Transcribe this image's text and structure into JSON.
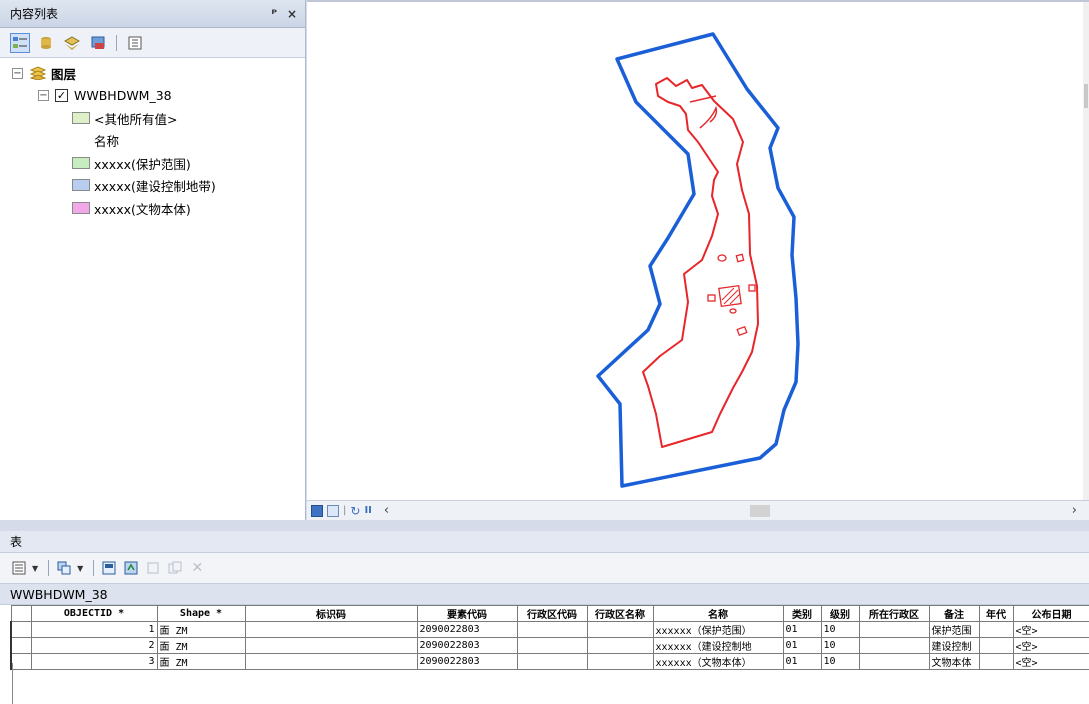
{
  "toc": {
    "title": "内容列表",
    "pin_glyph": "ᴾ",
    "close_glyph": "×",
    "tree": {
      "root_label": "图层",
      "layer_label": "WWBHDWM_38",
      "legend": [
        {
          "label": "<其他所有值>",
          "color": "#dff0c8"
        },
        {
          "label": "名称",
          "color": null
        },
        {
          "label": "xxxxx(保护范围)",
          "color": "#c6ecc0"
        },
        {
          "label": "xxxxx(建设控制地带)",
          "color": "#b8cdf0"
        },
        {
          "label": "xxxxx(文物本体)",
          "color": "#f0a8e8"
        }
      ]
    }
  },
  "table_panel": {
    "title": "表",
    "tab_label": "WWBHDWM_38",
    "columns": [
      "OBJECTID *",
      "Shape *",
      "标识码",
      "要素代码",
      "行政区代码",
      "行政区名称",
      "名称",
      "类别",
      "级别",
      "所在行政区",
      "备注",
      "年代",
      "公布日期"
    ],
    "rows": [
      [
        "1",
        "面 ZM",
        "",
        "2090022803",
        "",
        "",
        "xxxxxx（保护范围）",
        "01",
        "10",
        "",
        "保护范围",
        "",
        "<空>"
      ],
      [
        "2",
        "面 ZM",
        "",
        "2090022803",
        "",
        "",
        "xxxxxx（建设控制地",
        "01",
        "10",
        "",
        "建设控制",
        "",
        "<空>"
      ],
      [
        "3",
        "面 ZM",
        "",
        "2090022803",
        "",
        "",
        "xxxxxx（文物本体）",
        "01",
        "10",
        "",
        "文物本体",
        "",
        "<空>"
      ]
    ]
  },
  "colors": {
    "protect_outline": "#e8262a",
    "control_outline": "#1a5fd8"
  }
}
